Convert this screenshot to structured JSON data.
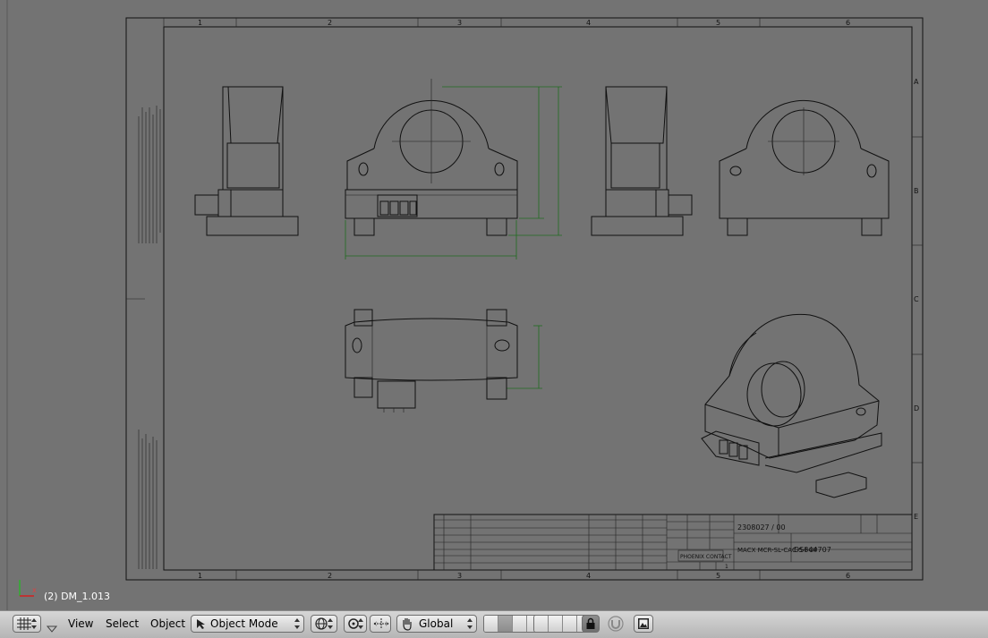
{
  "viewport": {
    "object_info": "(2) DM_1.013",
    "drawing": {
      "column_labels": [
        "1",
        "2",
        "3",
        "4",
        "5",
        "6"
      ],
      "row_labels": [
        "A",
        "B",
        "C",
        "D",
        "E"
      ],
      "title_block": {
        "drawing_number": "2308027 / 00",
        "type": "MACX MCR-SL-CAC-5-I-UP",
        "doc_number": "DS844707",
        "logo_text": "PHOENIX CONTACT",
        "sheet": "1"
      }
    }
  },
  "header": {
    "menus": [
      {
        "label": "View"
      },
      {
        "label": "Select"
      },
      {
        "label": "Object"
      }
    ],
    "mode": {
      "label": "Object Mode",
      "icon": "cursor-arrow-icon"
    },
    "orientation": {
      "label": "Global",
      "icon": "hand-transform-icon"
    },
    "icons": {
      "editor_type": "grid-editor-icon",
      "view_shading": "globe-shading-icon",
      "pivot": "pivot-icon",
      "snap": "snap-magnet-icon",
      "lock": "lock-icon",
      "render": "render-image-icon"
    },
    "colors": {
      "header_bg": "#c8c8c8",
      "viewport_bg": "#737373",
      "axis_x": "#d42020",
      "axis_z": "#30b030",
      "dimension": "#1f6b1f"
    }
  }
}
